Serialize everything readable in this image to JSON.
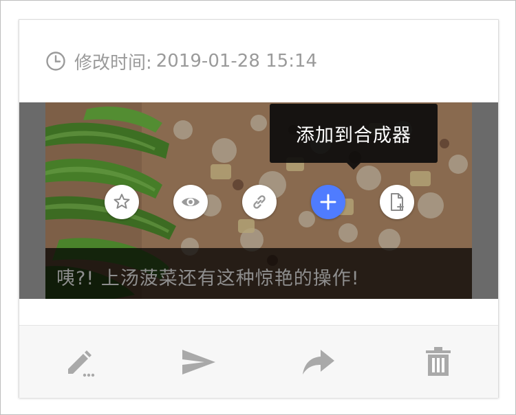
{
  "card": {
    "modified_label": "修改时间:",
    "modified_value": "2019-01-28 15:14",
    "clock_icon": "clock-icon"
  },
  "media": {
    "tooltip": "添加到合成器",
    "caption": "咦?! 上汤菠菜还有这种惊艳的操作!",
    "actions": [
      {
        "name": "favorite",
        "icon": "star-icon"
      },
      {
        "name": "preview",
        "icon": "eye-icon"
      },
      {
        "name": "link",
        "icon": "link-icon"
      },
      {
        "name": "add-to-composer",
        "icon": "plus-icon",
        "active": true
      },
      {
        "name": "add-document",
        "icon": "file-plus-icon"
      }
    ],
    "accent_color": "#4f7cff"
  },
  "footer": {
    "actions": [
      {
        "name": "edit",
        "icon": "pencil-icon"
      },
      {
        "name": "send",
        "icon": "send-icon"
      },
      {
        "name": "share",
        "icon": "share-icon"
      },
      {
        "name": "delete",
        "icon": "trash-icon"
      }
    ],
    "icon_color": "#a9a9a9"
  }
}
